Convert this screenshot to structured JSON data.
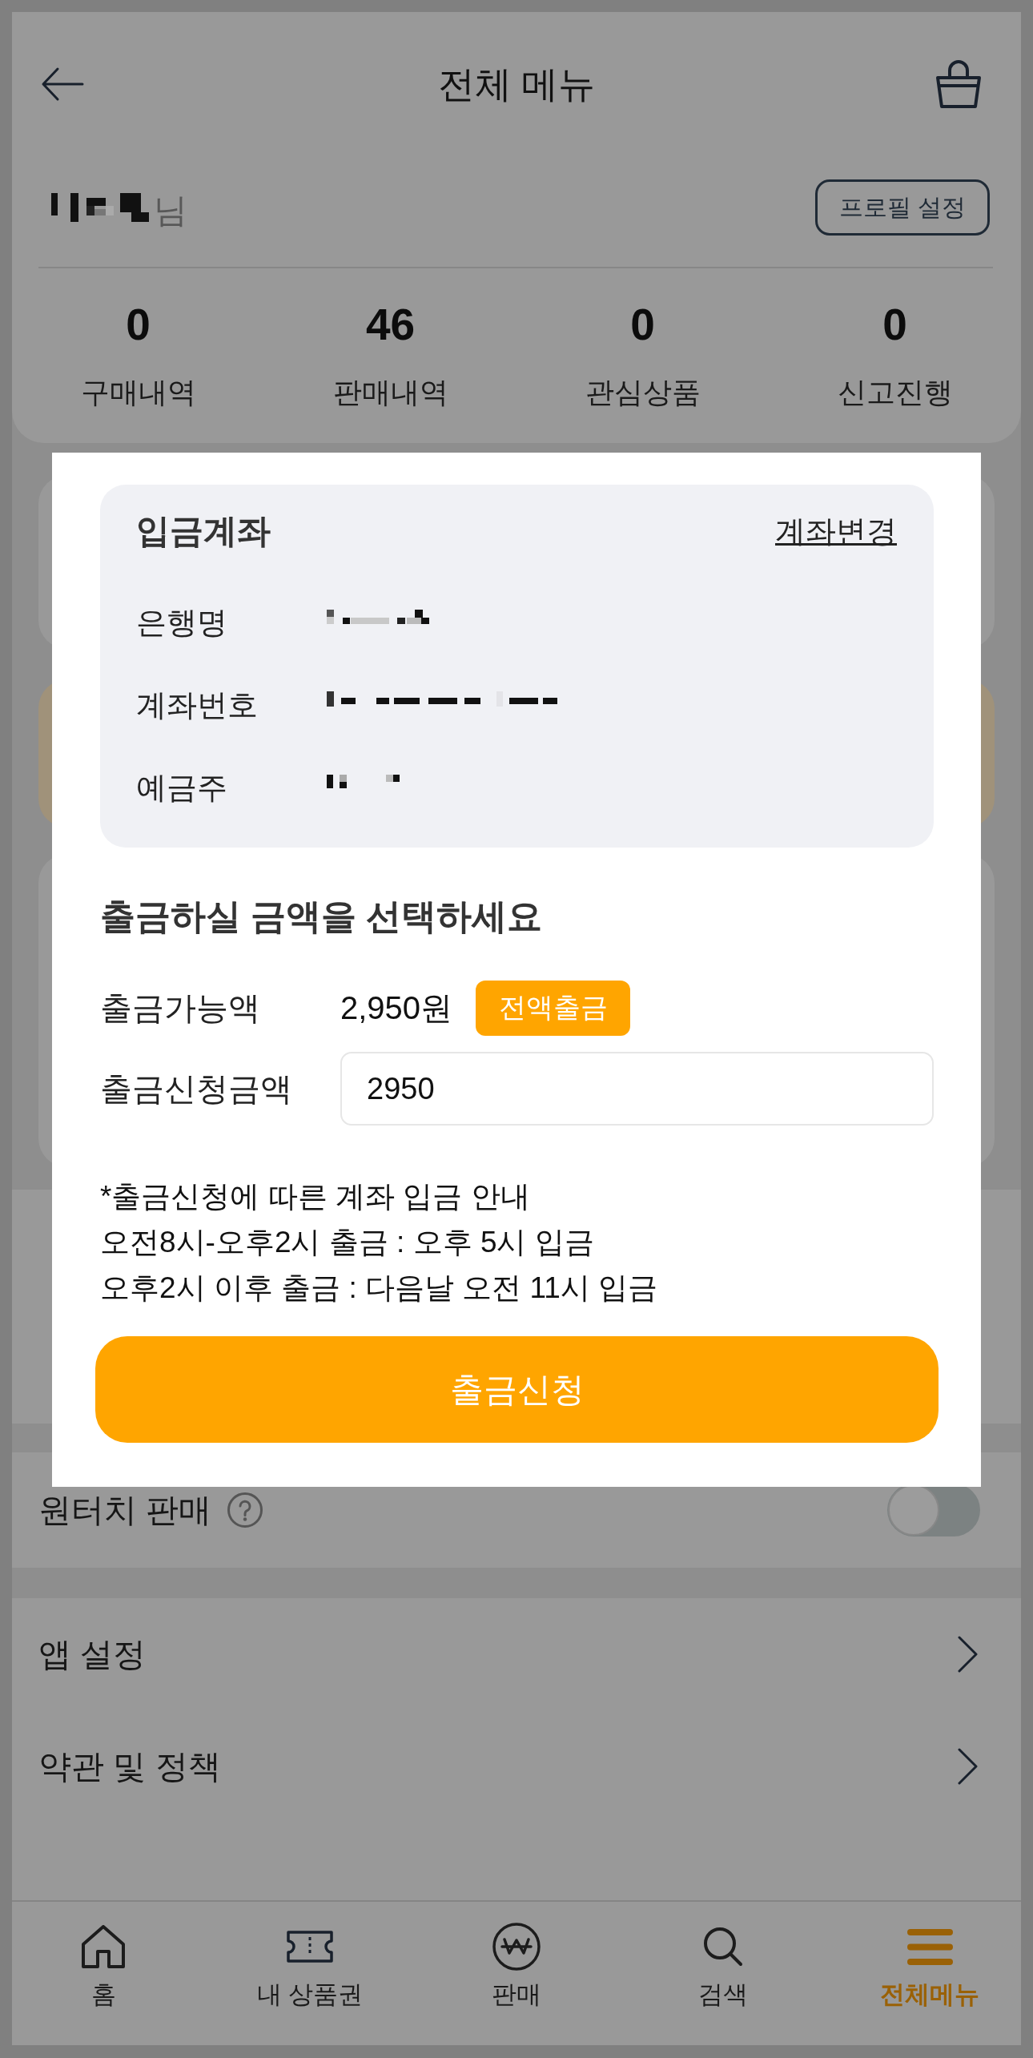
{
  "header": {
    "title": "전체 메뉴"
  },
  "profile": {
    "name_redacted": true,
    "suffix": "님",
    "settings_button": "프로필 설정"
  },
  "stats": [
    {
      "value": "0",
      "label": "구매내역"
    },
    {
      "value": "46",
      "label": "판매내역"
    },
    {
      "value": "0",
      "label": "관심상품"
    },
    {
      "value": "0",
      "label": "신고진행"
    }
  ],
  "withdrawal_dialog": {
    "account": {
      "title": "입금계좌",
      "change_link": "계좌변경",
      "fields": [
        {
          "label": "은행명",
          "redacted": true
        },
        {
          "label": "계좌번호",
          "redacted": true
        },
        {
          "label": "예금주",
          "redacted": true
        }
      ]
    },
    "heading": "출금하실 금액을 선택하세요",
    "available": {
      "label": "출금가능액",
      "value": "2,950원",
      "button": "전액출금"
    },
    "request": {
      "label": "출금신청금액",
      "value": "2950"
    },
    "notes": [
      "*출금신청에 따른 계좌 입금 안내",
      "오전8시-오후2시 출금 : 오후 5시 입금",
      "오후2시 이후 출금 : 다음날 오전 11시 입금"
    ],
    "submit": "출금신청"
  },
  "sections": [
    {
      "rows": [
        {
          "kind": "toggle",
          "label": "원터치 판매",
          "help": true,
          "on": false
        }
      ]
    },
    {
      "rows": [
        {
          "kind": "link",
          "label": "앱 설정"
        },
        {
          "kind": "link",
          "label": "약관 및 정책"
        }
      ]
    }
  ],
  "bottom_nav": [
    {
      "label": "홈",
      "selected": false
    },
    {
      "label": "내 상품권",
      "selected": false
    },
    {
      "label": "판매",
      "selected": false
    },
    {
      "label": "검색",
      "selected": false
    },
    {
      "label": "전체메뉴",
      "selected": true
    }
  ]
}
